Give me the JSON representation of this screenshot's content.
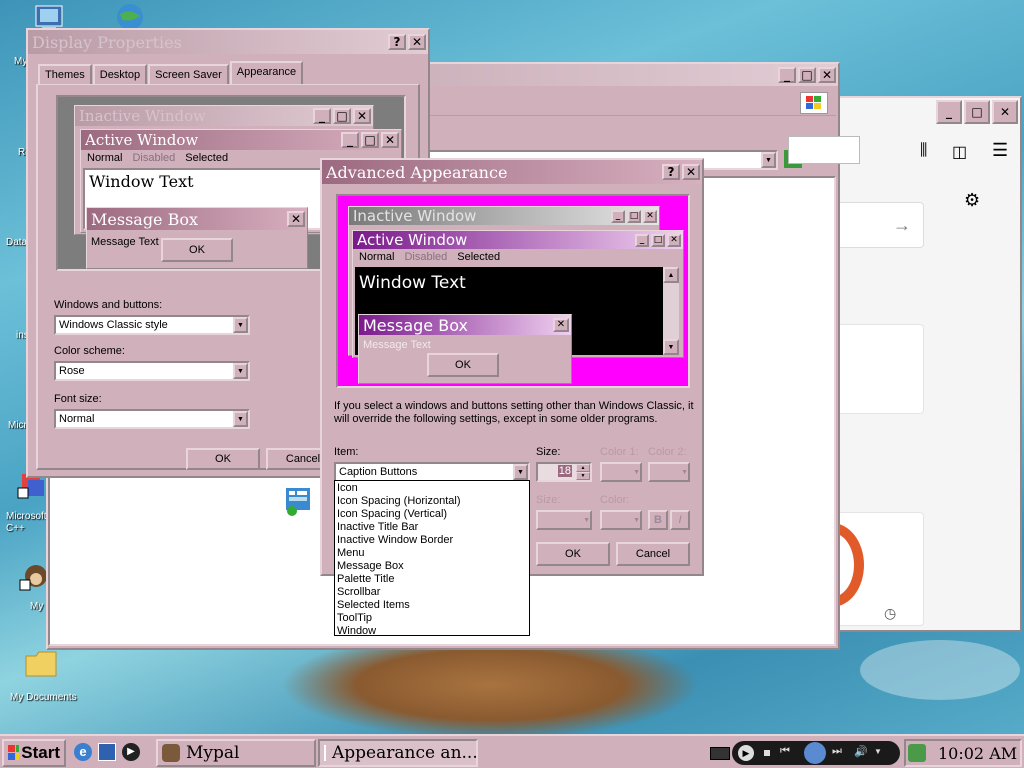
{
  "colors": {
    "face": "#cfb0bb",
    "accent": "#9c6a80",
    "magenta": "#ff00ff",
    "purple": "#7a1a8c"
  },
  "desktop": {
    "icons": [
      {
        "label": "My",
        "icon": "my-computer-icon"
      },
      {
        "label": "Re",
        "icon": "recycle-bin-icon"
      },
      {
        "label": "Data",
        "icon": "database-icon"
      },
      {
        "label": "ins",
        "icon": "installer-icon"
      },
      {
        "label": "Micro",
        "icon": "microsoft-icon"
      },
      {
        "label": "Microsoft C++",
        "icon": "cpp-shortcut-icon"
      },
      {
        "label": "My",
        "icon": "monkey-shortcut-icon"
      },
      {
        "label": "My Documents",
        "icon": "folder-icon"
      }
    ]
  },
  "mypal": {
    "go_label": "Go"
  },
  "display": {
    "title": "Display Properties",
    "tabs": [
      "Themes",
      "Desktop",
      "Screen Saver",
      "Appearance"
    ],
    "preview": {
      "inactive": "Inactive Window",
      "active": "Active Window",
      "menu": [
        "Normal",
        "Disabled",
        "Selected"
      ],
      "window_text": "Window Text",
      "message_box": "Message Box",
      "message_text": "Message Text",
      "ok": "OK"
    },
    "windows_buttons_label": "Windows and buttons:",
    "windows_buttons_value": "Windows Classic style",
    "color_scheme_label": "Color scheme:",
    "color_scheme_value": "Rose",
    "font_size_label": "Font size:",
    "font_size_value": "Normal",
    "ok": "OK",
    "cancel": "Cancel"
  },
  "advanced": {
    "title": "Advanced Appearance",
    "preview": {
      "inactive": "Inactive Window",
      "active": "Active Window",
      "menu": [
        "Normal",
        "Disabled",
        "Selected"
      ],
      "window_text": "Window Text",
      "message_box": "Message Box",
      "message_text": "Message Text",
      "ok": "OK"
    },
    "info": "If you select a windows and buttons setting other than Windows Classic, it will override the following settings, except in some older programs.",
    "item_label": "Item:",
    "item_value": "Caption Buttons",
    "size_label": "Size:",
    "size_value": "18",
    "color1_label": "Color 1:",
    "color2_label": "Color 2:",
    "font_size_label": "Size:",
    "font_color_label": "Color:",
    "bold": "B",
    "italic": "I",
    "items": [
      "Icon",
      "Icon Spacing (Horizontal)",
      "Icon Spacing (Vertical)",
      "Inactive Title Bar",
      "Inactive Window Border",
      "Menu",
      "Message Box",
      "Palette Title",
      "Scrollbar",
      "Selected Items",
      "ToolTip",
      "Window"
    ],
    "ok": "OK",
    "cancel": "Cancel"
  },
  "taskbar": {
    "start": "Start",
    "tasks": [
      "Mypal",
      "Appearance an..."
    ],
    "clock": "10:02 AM"
  }
}
